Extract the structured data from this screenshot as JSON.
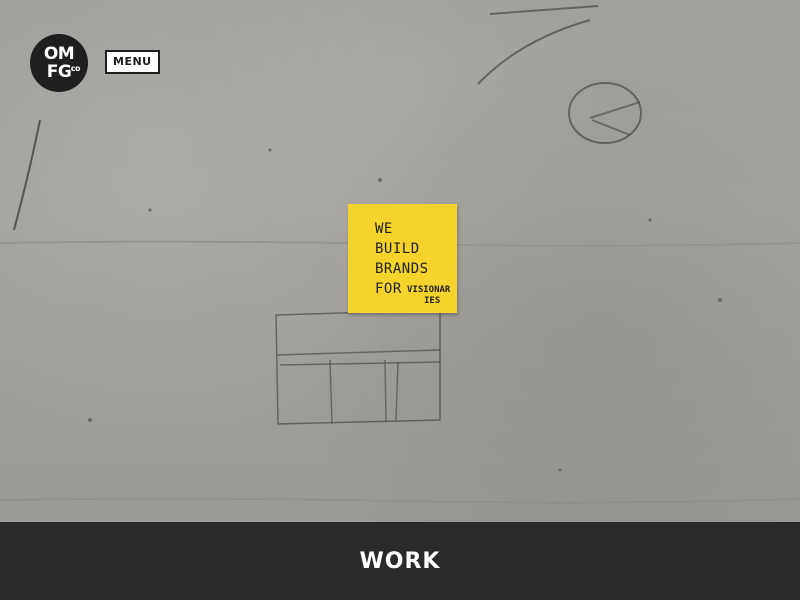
{
  "header": {
    "logo_top": "OM",
    "logo_bottom": "FG",
    "logo_co": "co",
    "menu_label": "MENU"
  },
  "hero": {
    "note_lines": [
      "WE",
      "BUILD",
      "BRANDS",
      "FOR"
    ],
    "note_small_1": "VISIONAR",
    "note_small_2": "IES"
  },
  "footer": {
    "link_label": "WORK"
  },
  "colors": {
    "sticky_note": "#f4d32a",
    "footer_bg": "#2a2a2a",
    "logo_bg": "#1f1f1f"
  }
}
